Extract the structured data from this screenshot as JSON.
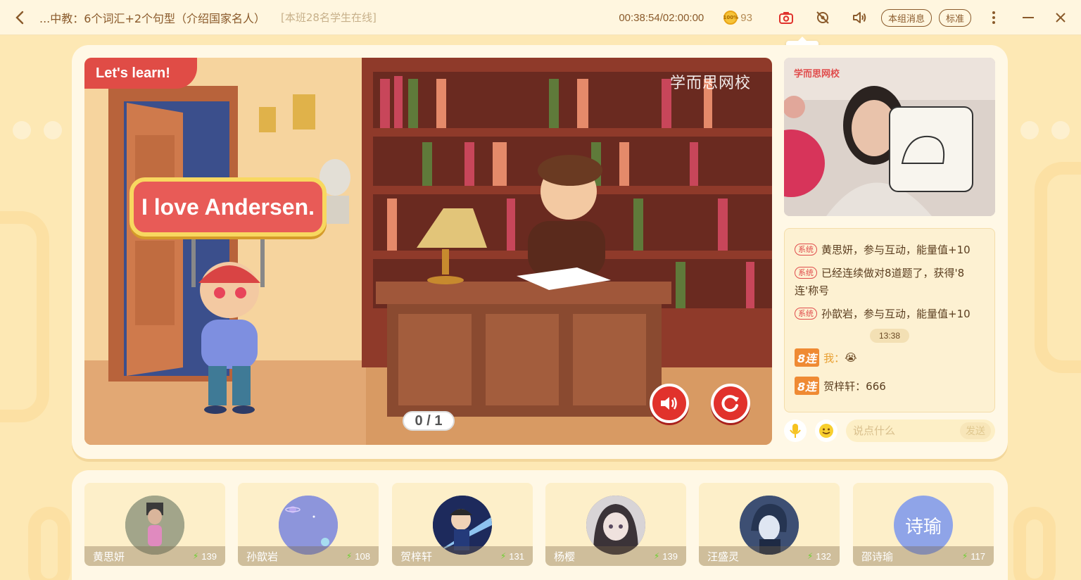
{
  "header": {
    "title": "...中教：6个词汇+2个句型（介绍国家名人）",
    "online_status": "[本班28名学生在线]",
    "timer": "00:38:54/02:00:00",
    "coins": "93",
    "coin_label": "100%",
    "group_msg_label": "本组消息",
    "quality_label": "标准",
    "screenshot_tooltip": "截屏"
  },
  "stage": {
    "badge": "Let's learn!",
    "watermark": "学而思网校",
    "sentence": "I love Andersen.",
    "progress": "0 / 1"
  },
  "teacher": {
    "logo": "学而思网校"
  },
  "chat": {
    "sys_tag": "系统",
    "messages": [
      "黄思妍，参与互动，能量值+10",
      "已经连续做对8道题了，获得'8连'称号",
      "孙歆岩，参与互动，能量值+10"
    ],
    "time": "13:38",
    "streak_badge": "8连",
    "me_label": "我：",
    "me_emoji": "😭",
    "other_name": "贺梓轩",
    "other_text": "：666",
    "input_placeholder": "说点什么",
    "send_label": "发送"
  },
  "students": [
    {
      "name": "黄思妍",
      "score": "139",
      "avatar_color": "#8e9a7a"
    },
    {
      "name": "孙歆岩",
      "score": "108",
      "avatar_color": "#8d95db"
    },
    {
      "name": "贺梓轩",
      "score": "131",
      "avatar_color": "#1d2a5c"
    },
    {
      "name": "杨樱",
      "score": "139",
      "avatar_color": "#6f6a72"
    },
    {
      "name": "汪盛灵",
      "score": "132",
      "avatar_color": "#3d4f73"
    },
    {
      "name": "邵诗瑜",
      "score": "117",
      "avatar_color": "#8fa4e8",
      "avatar_text": "诗瑜"
    }
  ]
}
